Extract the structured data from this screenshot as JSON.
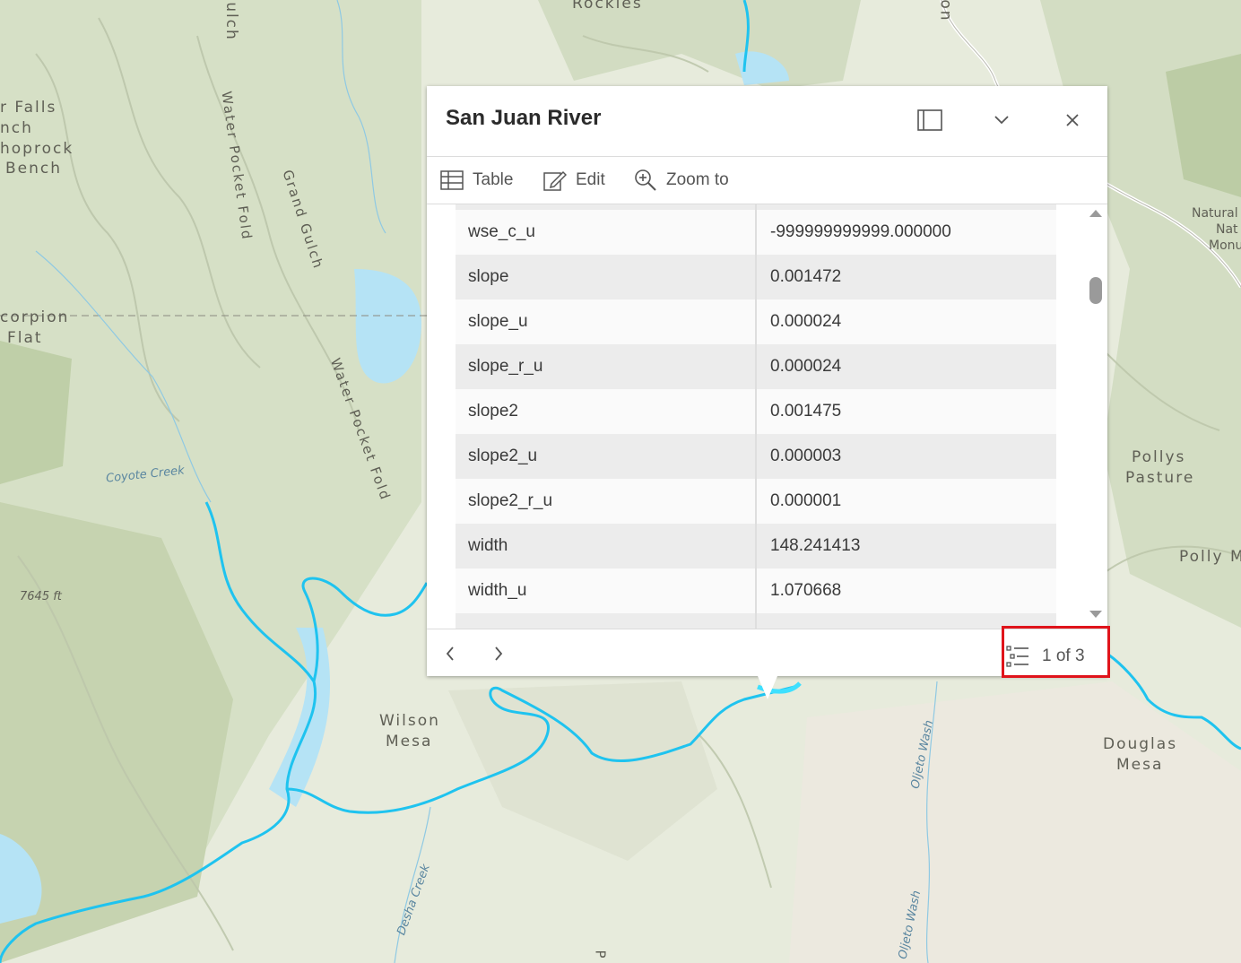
{
  "map": {
    "labels": {
      "rockies": "Rockies",
      "ulch": "ulch",
      "falls": "r Falls",
      "nch": "nch",
      "hoprock": "hoprock",
      "bench": "Bench",
      "scorpion": "corpion",
      "flat": "Flat",
      "water_pocket_fold_1": "Water Pocket Fold",
      "grand_gulch": "Grand Gulch",
      "water_pocket_fold_2": "Water Pocket Fold",
      "coyote_creek": "Coyote Creek",
      "elevation": "7645 ft",
      "wilson": "Wilson",
      "mesa": "Mesa",
      "natural": "Natural",
      "nat": "Nat",
      "monu": "Monu",
      "pollys": "Pollys",
      "pasture": "Pasture",
      "polly_m": "Polly M",
      "douglas": "Douglas",
      "douglas_mesa": "Mesa",
      "oljeto_wash_1": "Oljeto Wash",
      "oljeto_wash_2": "Oljeto Wash",
      "desha_creek": "Desha Creek",
      "on": "on",
      "p": "P"
    }
  },
  "popup": {
    "title": "San Juan River",
    "actions": {
      "table": "Table",
      "edit": "Edit",
      "zoom_to": "Zoom to"
    },
    "rows": [
      {
        "key": "wse_c_u",
        "value": "-999999999999.000000"
      },
      {
        "key": "slope",
        "value": "0.001472"
      },
      {
        "key": "slope_u",
        "value": "0.000024"
      },
      {
        "key": "slope_r_u",
        "value": "0.000024"
      },
      {
        "key": "slope2",
        "value": "0.001475"
      },
      {
        "key": "slope2_u",
        "value": "0.000003"
      },
      {
        "key": "slope2_r_u",
        "value": "0.000001"
      },
      {
        "key": "width",
        "value": "148.241413"
      },
      {
        "key": "width_u",
        "value": "1.070668"
      }
    ],
    "feature_count": "1 of 3",
    "scroll_position": 0.14
  },
  "colors": {
    "river": "#1fc3ef",
    "lake": "#b5e3f5",
    "highlight": "#e0141b"
  }
}
